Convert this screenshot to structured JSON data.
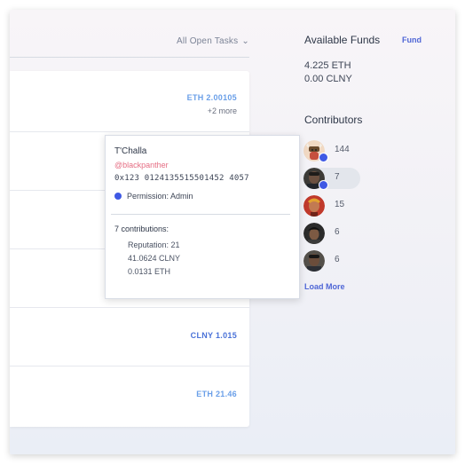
{
  "filter": {
    "label": "All Open Tasks"
  },
  "tasks": [
    {
      "amount": "ETH 2.00105",
      "more": "+2 more"
    },
    {
      "amount": ""
    },
    {
      "amount": ""
    },
    {
      "amount": ""
    },
    {
      "amount": "CLNY 1.015"
    },
    {
      "amount": "ETH 21.46"
    }
  ],
  "funds": {
    "title": "Available Funds",
    "fund_link": "Fund",
    "balances": [
      "4.225 ETH",
      "0.00 CLNY"
    ]
  },
  "contributors": {
    "title": "Contributors",
    "items": [
      {
        "count": "144"
      },
      {
        "count": "7"
      },
      {
        "count": "15"
      },
      {
        "count": "6"
      },
      {
        "count": "6"
      }
    ],
    "load_more": "Load More"
  },
  "tooltip": {
    "name": "T'Challa",
    "handle": "@blackpanther",
    "address": "0x123 0124135515501452 4057",
    "permission": "Permission: Admin",
    "contributions_title": "7 contributions:",
    "reputation": "Reputation: 21",
    "clny": "41.0624 CLNY",
    "eth": "0.0131 ETH"
  },
  "colors": {
    "accent": "#4f66d6",
    "status_dot": "#3f59e4",
    "handle": "#e56d83"
  }
}
